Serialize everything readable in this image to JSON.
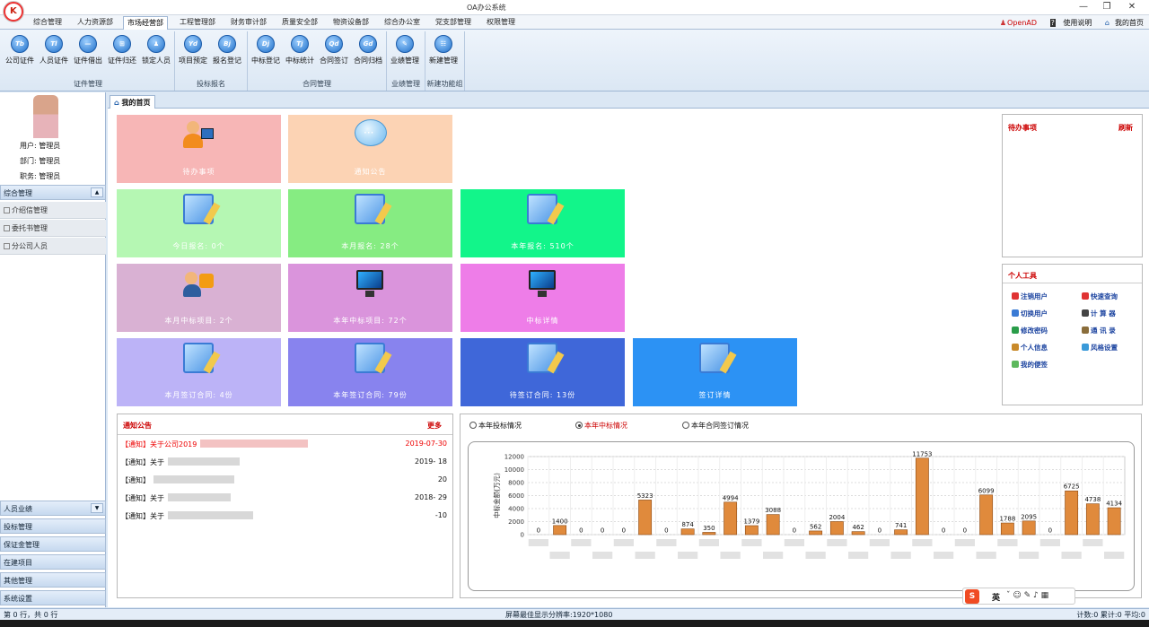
{
  "window": {
    "title": "OA办公系统",
    "minimize": "—",
    "restore": "❐",
    "close": "✕"
  },
  "menu": {
    "tabs": [
      "综合管理",
      "人力资源部",
      "市场经营部",
      "工程管理部",
      "财务审计部",
      "质量安全部",
      "物资设备部",
      "综合办公室",
      "党支部管理",
      "权限管理"
    ],
    "active": "市场经营部",
    "right": {
      "user": "OpenAD",
      "help": "使用说明",
      "home": "我的首页"
    }
  },
  "ribbon": {
    "groups": [
      {
        "label": "证件管理",
        "buttons": [
          {
            "label": "公司证件",
            "glyph": "Tb"
          },
          {
            "label": "人员证件",
            "glyph": "Tl"
          },
          {
            "label": "证件借出",
            "glyph": "—"
          },
          {
            "label": "证件归还",
            "glyph": "⊞"
          },
          {
            "label": "锁定人员",
            "glyph": "♟"
          }
        ]
      },
      {
        "label": "投标报名",
        "buttons": [
          {
            "label": "项目预定",
            "glyph": "Yd"
          },
          {
            "label": "报名登记",
            "glyph": "Bj"
          }
        ]
      },
      {
        "label": "合同管理",
        "buttons": [
          {
            "label": "中标登记",
            "glyph": "Dj"
          },
          {
            "label": "中标统计",
            "glyph": "Tj"
          },
          {
            "label": "合同签订",
            "glyph": "Qd"
          },
          {
            "label": "合同归档",
            "glyph": "Gd"
          }
        ]
      },
      {
        "label": "业绩管理",
        "buttons": [
          {
            "label": "业绩管理",
            "glyph": "✎"
          }
        ]
      },
      {
        "label": "新建功能组",
        "buttons": [
          {
            "label": "新建管理",
            "glyph": "☷"
          }
        ]
      }
    ]
  },
  "left": {
    "user": "用户: 管理员",
    "dept": "部门: 管理员",
    "role": "职务: 管理员",
    "sections": [
      {
        "label": "综合管理",
        "items": [
          "介绍信管理",
          "委托书管理",
          "分公司人员"
        ]
      }
    ],
    "bottom_sections": [
      "人员业绩",
      "投标管理",
      "保证金管理",
      "在建项目",
      "其他管理",
      "系统设置"
    ]
  },
  "tabs": {
    "home": "我的首页"
  },
  "tiles": [
    {
      "label": "待办事项",
      "color": "#f7b6b6",
      "icon": "person-computer-icon"
    },
    {
      "label": "通知公告",
      "color": "#fcd3b4",
      "icon": "chat-bubble-icon"
    },
    {
      "label": "今日报名: 0个",
      "color": "#b5f7b3",
      "icon": "image-pencil-icon"
    },
    {
      "label": "本月报名: 28个",
      "color": "#86ec82",
      "icon": "image-pencil-icon"
    },
    {
      "label": "本年报名: 510个",
      "color": "#12f58a",
      "icon": "image-pencil-icon"
    },
    {
      "label": "本月中标项目: 2个",
      "color": "#d9b1d3",
      "icon": "person-rss-icon"
    },
    {
      "label": "本年中标项目: 72个",
      "color": "#da94dc",
      "icon": "monitor-icon"
    },
    {
      "label": "中标详情",
      "color": "#ee7de8",
      "icon": "monitor-icon"
    },
    {
      "label": "本月签订合同: 4份",
      "color": "#bcb3f7",
      "icon": "image-pencil-icon"
    },
    {
      "label": "本年签订合同: 79份",
      "color": "#8883ee",
      "icon": "image-pencil-icon"
    },
    {
      "label": "待签订合同: 13份",
      "color": "#3f67d9",
      "icon": "image-pencil-icon"
    },
    {
      "label": "签订详情",
      "color": "#2c92f4",
      "icon": "image-pencil-icon"
    }
  ],
  "todo": {
    "title": "待办事项",
    "refresh": "刷新"
  },
  "tools": {
    "title": "个人工具",
    "items": [
      {
        "label": "注销用户",
        "color": "#e03333"
      },
      {
        "label": "快速查询",
        "color": "#e03333"
      },
      {
        "label": "切换用户",
        "color": "#3a7bd5"
      },
      {
        "label": "计 算 器",
        "color": "#444444"
      },
      {
        "label": "修改密码",
        "color": "#2a9d4a"
      },
      {
        "label": "通 讯 录",
        "color": "#8a6d3b"
      },
      {
        "label": "个人信息",
        "color": "#c98a2a"
      },
      {
        "label": "风格设置",
        "color": "#3a9ad9"
      },
      {
        "label": "我的便签",
        "color": "#5cb85c"
      }
    ]
  },
  "notice": {
    "title": "通知公告",
    "more": "更多",
    "items": [
      {
        "text": "【通知】关于公司2019",
        "date": "2019-07-30",
        "highlight": true
      },
      {
        "text": "【通知】关于",
        "date": "2019-  18",
        "highlight": false
      },
      {
        "text": "【通知】",
        "date": "    20",
        "highlight": false
      },
      {
        "text": "【通知】关于",
        "date": "2018-  29",
        "highlight": false
      },
      {
        "text": "【通知】关于",
        "date": "   -10",
        "highlight": false
      }
    ]
  },
  "chart_options": [
    "本年投标情况",
    "本年中标情况",
    "本年合同签订情况"
  ],
  "chart_selected": 1,
  "chart_data": {
    "type": "bar",
    "ylabel": "中标金额(万元)",
    "ylim": [
      0,
      12000
    ],
    "yticks": [
      0,
      2000,
      4000,
      6000,
      8000,
      10000,
      12000
    ],
    "values": [
      0,
      1400,
      0,
      0,
      0,
      5323,
      0,
      874,
      350,
      4994,
      1379,
      3088,
      0,
      562,
      2004,
      462,
      0,
      741,
      11753,
      0,
      0,
      6099,
      1788,
      2095,
      0,
      6725,
      4738,
      4134
    ],
    "bar_color": "#e08a3c"
  },
  "status": {
    "left": "第 0 行，共 0 行",
    "center": "屏幕最佳显示分辨率:1920*1080",
    "right": "计数:0  累计:0  平均:0"
  },
  "ime": {
    "logo": "S",
    "lang": "英"
  }
}
